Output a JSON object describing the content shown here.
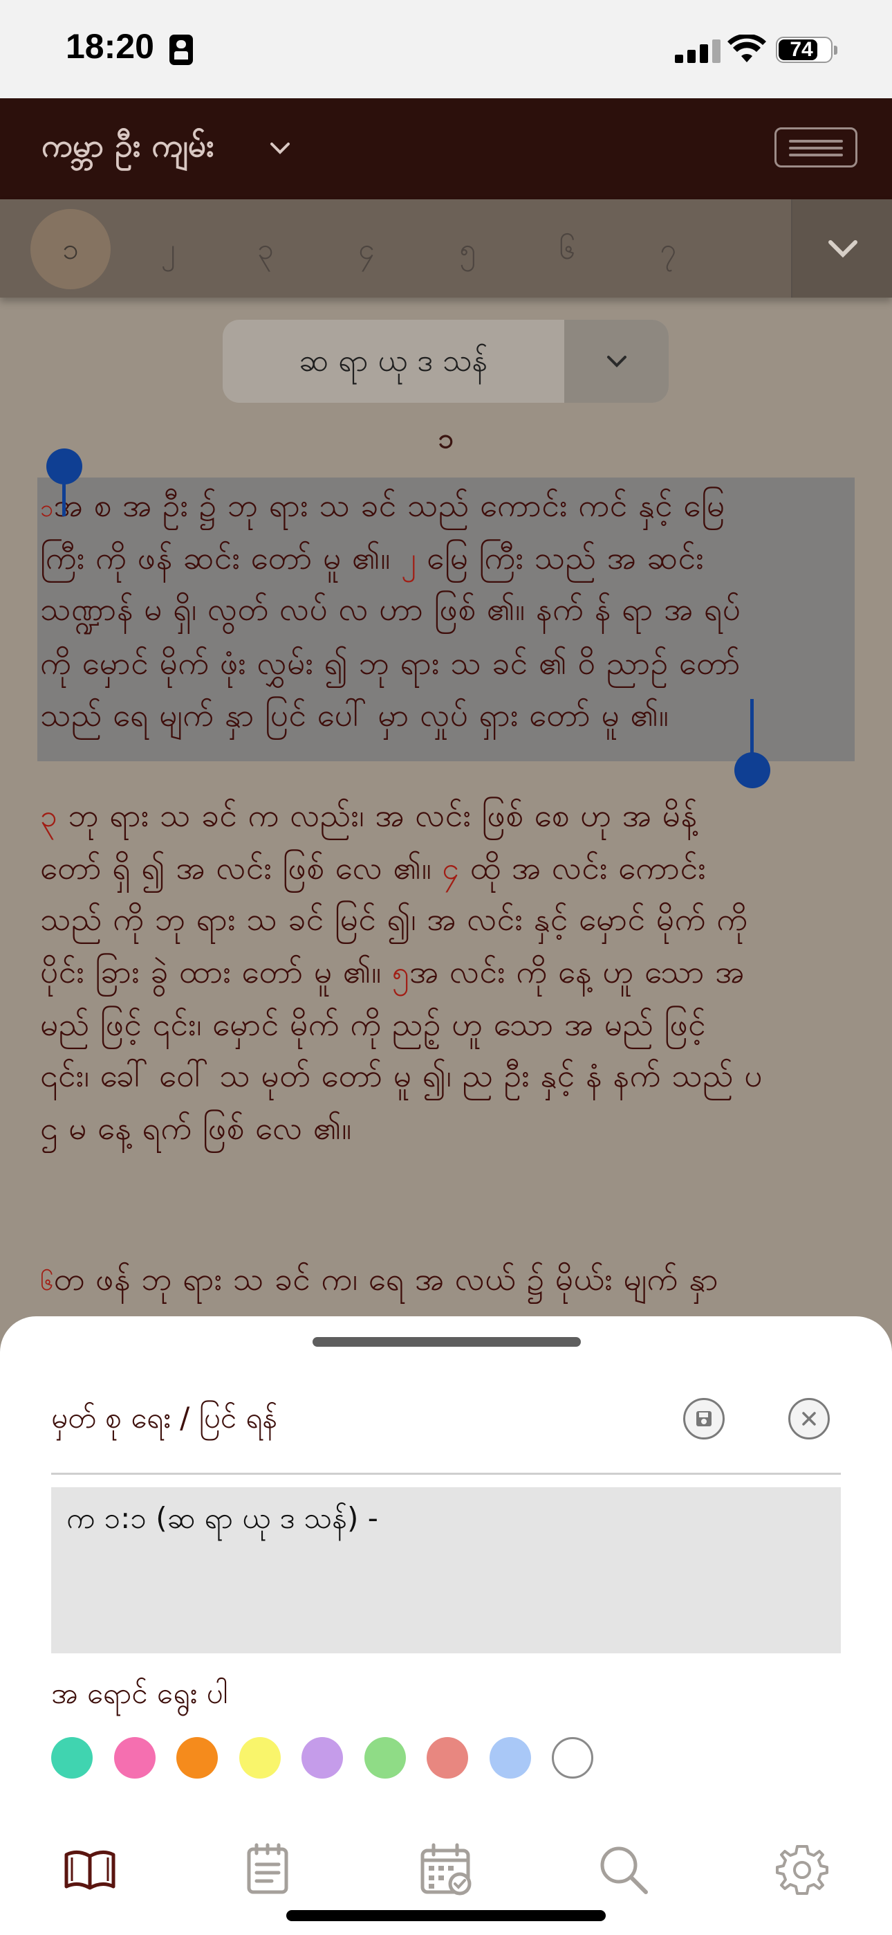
{
  "status_bar": {
    "time": "18:20",
    "battery_pct": "74"
  },
  "header": {
    "book_name": "ကမ္ဘာ ဦး ကျမ်း"
  },
  "chapters": {
    "items": [
      "၁",
      "၂",
      "၃",
      "၄",
      "၅",
      "၆",
      "၇"
    ],
    "selected": "၁"
  },
  "version": {
    "name": "ဆ ရာ ယု ဒ သန်"
  },
  "chapter_heading": "၁",
  "text_lines": [
    {
      "parts": [
        {
          "vn": "၁"
        },
        {
          "t": "အ စ အ ဦး ၌ ဘု ရား သ ခင် သည် ကောင်း ကင် နှင့် မြေ"
        }
      ]
    },
    {
      "parts": [
        {
          "t": "ကြီး ကို ဖန် ဆင်း တော် မူ ၏။ "
        },
        {
          "vn": "၂"
        },
        {
          "t": " မြေ ကြီး သည် အ ဆင်း"
        }
      ]
    },
    {
      "parts": [
        {
          "t": "သဏ္ဍာန် မ ရှိ၊ လွတ် လပ် လ ဟာ ဖြစ် ၏။ နက် န် ရာ အ ရပ်"
        }
      ]
    },
    {
      "parts": [
        {
          "t": "ကို မှောင် မိုက် ဖုံး လွှမ်း ၍ ဘု ရား သ ခင် ၏ ဝိ ညာဉ် တော်"
        }
      ]
    },
    {
      "parts": [
        {
          "t": "သည် ရေ မျက် နှာ ပြင် ပေါ် မှာ လှုပ် ရှား တော် မူ ၏။"
        }
      ]
    },
    {
      "parts": [
        {
          "vn": "၃"
        },
        {
          "t": " ဘု ရား သ ခင် က လည်း၊ အ လင်း ဖြစ် စေ ဟု အ မိန့်"
        }
      ]
    },
    {
      "parts": [
        {
          "t": "တော် ရှိ ၍ အ လင်း ဖြစ် လေ ၏။ "
        },
        {
          "vn": "၄"
        },
        {
          "t": " ထို အ လင်း ကောင်း"
        }
      ]
    },
    {
      "parts": [
        {
          "t": "သည် ကို ဘု ရား သ ခင် မြင် ၍၊ အ လင်း နှင့် မှောင် မိုက် ကို"
        }
      ]
    },
    {
      "parts": [
        {
          "t": "ပိုင်း ခြား ခွဲ ထား တော် မူ ၏။ "
        },
        {
          "vn": "၅"
        },
        {
          "t": "အ လင်း ကို နေ့ ဟူ သော အ"
        }
      ]
    },
    {
      "parts": [
        {
          "t": "မည် ဖြင့် ၎င်း၊ မှောင် မိုက် ကို ညဥ့် ဟူ သော အ မည် ဖြင့်"
        }
      ]
    },
    {
      "parts": [
        {
          "t": "၎င်း၊ ခေါ် ဝေါ် သ မုတ် တော် မူ ၍၊ ည ဦး နှင့် နံ နက် သည် ပ"
        }
      ]
    },
    {
      "parts": [
        {
          "t": "ဌ မ နေ့ ရက် ဖြစ် လေ ၏။"
        }
      ]
    },
    {
      "parts": [
        {
          "vn": "၆"
        },
        {
          "t": "တ ဖန် ဘု ရား သ ခင် က၊ ရေ အ လယ် ၌ မိုယ်း မျက် နှာ"
        }
      ]
    }
  ],
  "note_sheet": {
    "title": "မှတ် စု ရေး / ပြင် ရန်",
    "note_text": "က ၁:၁ (ဆ ရာ ယု ဒ သန်) -",
    "color_title": "အ ရောင် ရွေး ပါ",
    "colors": [
      "#40d4b0",
      "#f56fb0",
      "#f58b1c",
      "#f9f56b",
      "#c59cea",
      "#8fdc86",
      "#e88780",
      "#a9c8f7",
      "#ffffff"
    ]
  },
  "tabs": [
    "book-icon",
    "notes-icon",
    "calendar-icon",
    "search-icon",
    "settings-icon"
  ]
}
